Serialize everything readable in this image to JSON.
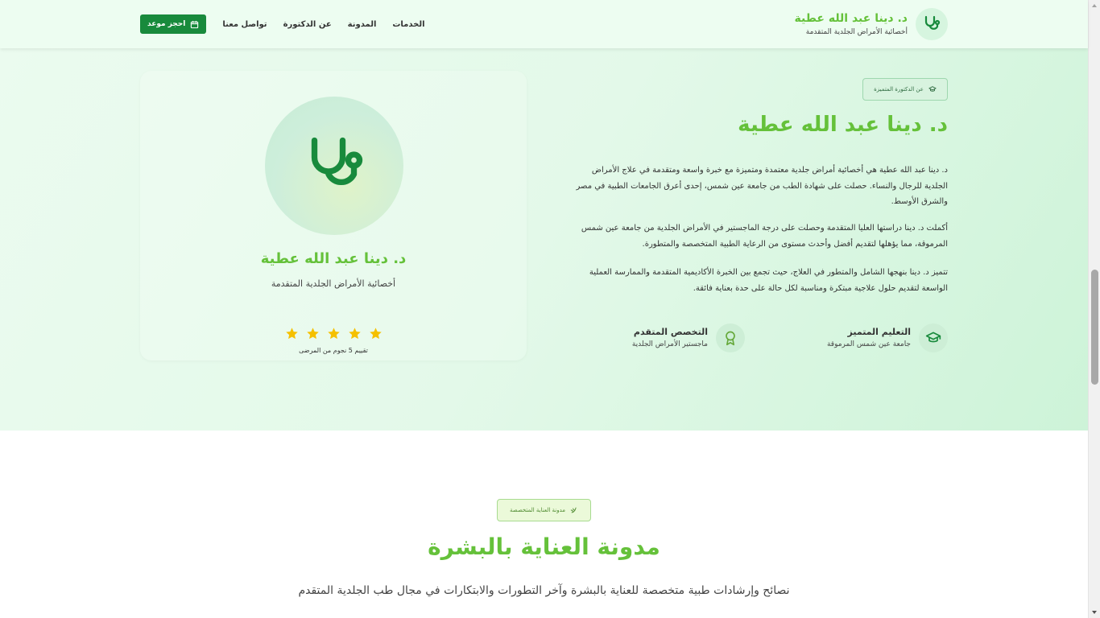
{
  "header": {
    "brand_name": "د. دينا عبد الله عطية",
    "brand_subtitle": "أخصائية الأمراض الجلدية المتقدمة",
    "logo_icon": "stethoscope-icon",
    "nav": [
      {
        "label": "الخدمات"
      },
      {
        "label": "المدونة"
      },
      {
        "label": "عن الدكتورة"
      },
      {
        "label": "تواصل معنا"
      }
    ],
    "book_button": {
      "label": "احجز موعد",
      "icon": "calendar-icon"
    }
  },
  "about": {
    "badge": "عن الدكتورة المتميزة",
    "badge_icon": "graduation-cap-icon",
    "title": "د. دينا عبد الله عطية",
    "paragraphs": [
      "د. دينا عبد الله عطية هي أخصائية أمراض جلدية معتمدة ومتميزة مع خبرة واسعة ومتقدمة في علاج الأمراض الجلدية للرجال والنساء. حصلت على شهادة الطب من جامعة عين شمس، إحدى أعرق الجامعات الطبية في مصر والشرق الأوسط.",
      "أكملت د. دينا دراستها العليا المتقدمة وحصلت على درجة الماجستير في الأمراض الجلدية من جامعة عين شمس المرموقة، مما يؤهلها لتقديم أفضل وأحدث مستوى من الرعاية الطبية المتخصصة والمتطورة.",
      "تتميز د. دينا بنهجها الشامل والمتطور في العلاج، حيث تجمع بين الخبرة الأكاديمية المتقدمة والممارسة العملية الواسعة لتقديم حلول علاجية مبتكرة ومناسبة لكل حالة على حدة بعناية فائقة."
    ],
    "features": [
      {
        "title": "التعليم المتميز",
        "subtitle": "جامعة عين شمس المرموقة",
        "icon": "graduation-cap-icon"
      },
      {
        "title": "التخصص المتقدم",
        "subtitle": "ماجستير الأمراض الجلدية",
        "icon": "award-icon"
      }
    ],
    "card": {
      "name": "د. دينا عبد الله عطية",
      "title": "أخصائية الأمراض الجلدية المتقدمة",
      "rating_stars": 5,
      "rating_text": "تقييم 5 نجوم من المرضى",
      "avatar_icon": "stethoscope-icon"
    }
  },
  "blog": {
    "badge": "مدونة العناية المتخصصة",
    "badge_icon": "sparkle-icon",
    "title": "مدونة العناية بالبشرة",
    "subtitle": "نصائح وإرشادات طبية متخصصة للعناية بالبشرة وآخر التطورات والابتكارات في مجال طب الجلدية المتقدم"
  },
  "colors": {
    "accent_green": "#65c13a",
    "dark_green": "#188a3c",
    "star_yellow": "#f5c000",
    "text": "#333333"
  }
}
